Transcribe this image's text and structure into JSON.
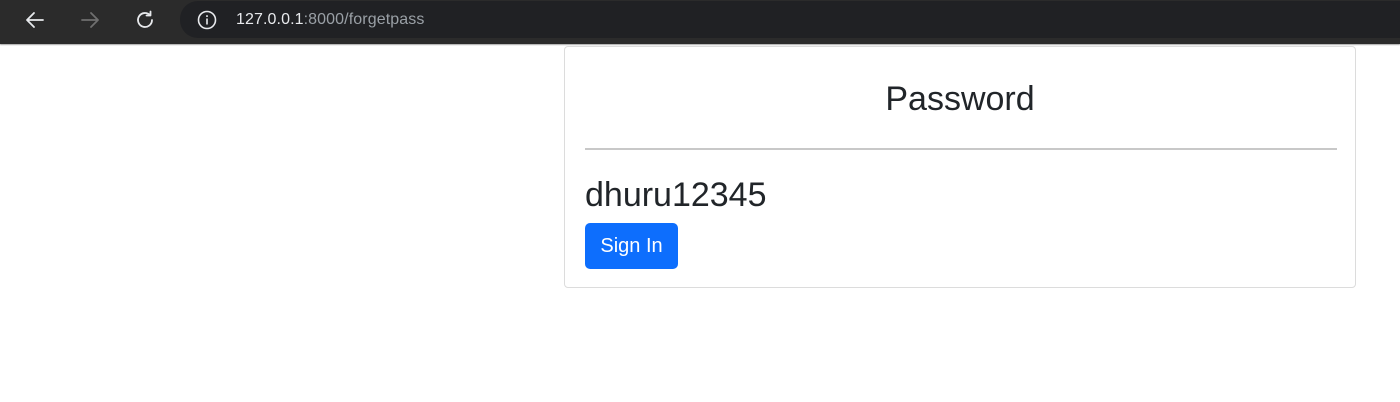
{
  "browser": {
    "address_bar": {
      "host": "127.0.0.1",
      "rest": ":8000/forgetpass"
    },
    "icons": {
      "back": "arrow-left-icon",
      "forward": "arrow-right-icon",
      "reload": "reload-icon",
      "info": "info-icon"
    },
    "colors": {
      "toolbar": "#2b2b2b",
      "omnibox": "#202124"
    }
  },
  "card": {
    "title": "Password",
    "password_value": "dhuru12345",
    "signin_label": "Sign In",
    "colors": {
      "button": "#0d6efd",
      "text": "#212529"
    }
  }
}
